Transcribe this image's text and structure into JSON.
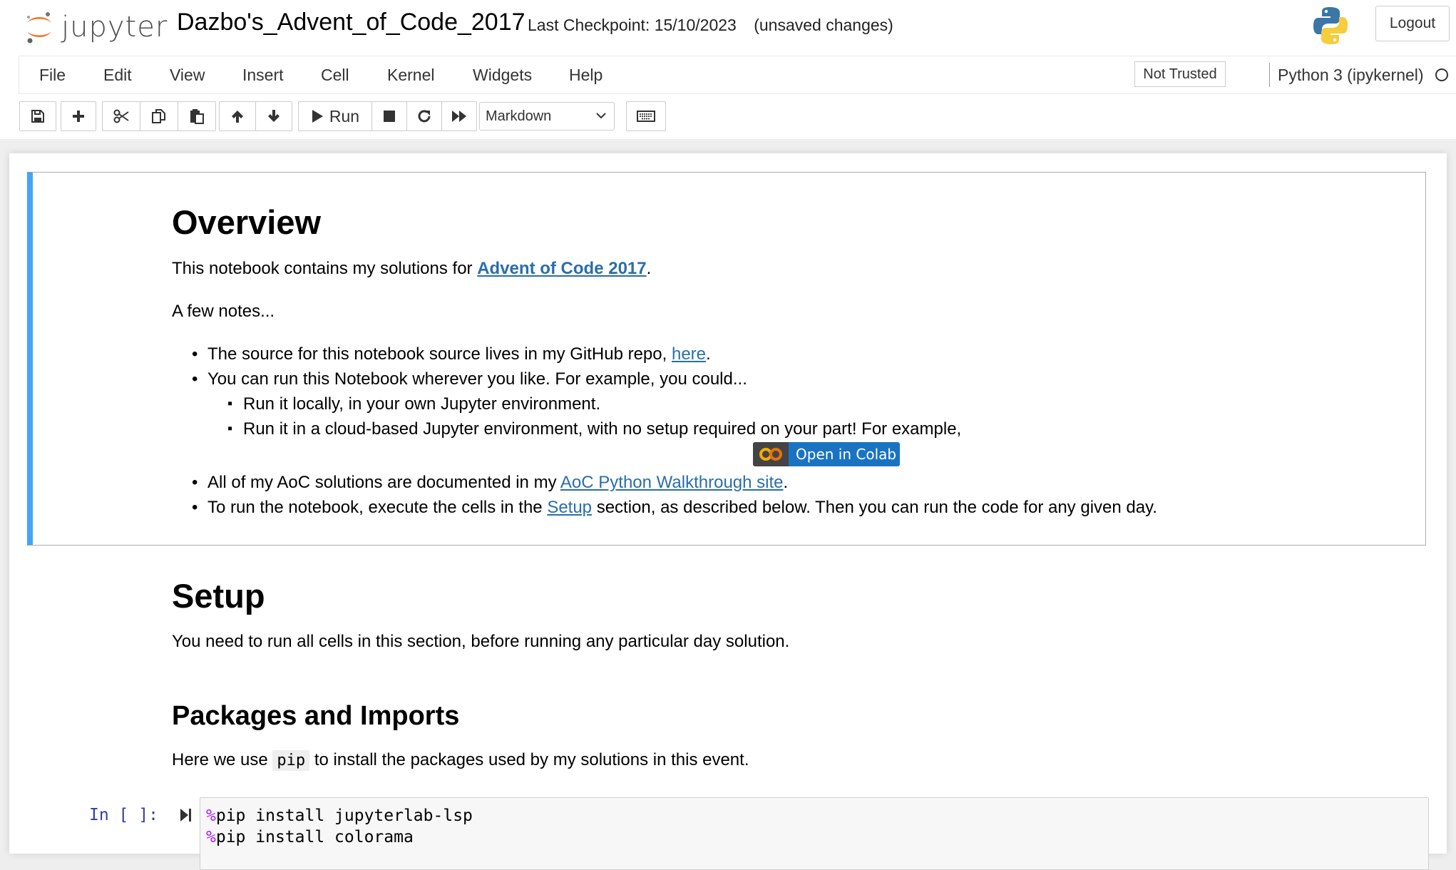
{
  "header": {
    "logo_text": "jupyter",
    "notebook_title": "Dazbo's_Advent_of_Code_2017",
    "checkpoint": "Last Checkpoint: 15/10/2023",
    "unsaved": "(unsaved changes)",
    "logout_label": "Logout"
  },
  "menubar": {
    "items": [
      "File",
      "Edit",
      "View",
      "Insert",
      "Cell",
      "Kernel",
      "Widgets",
      "Help"
    ],
    "trust_label": "Not Trusted",
    "kernel_name": "Python 3 (ipykernel)"
  },
  "toolbar": {
    "run_label": "Run",
    "cell_type": "Markdown",
    "icons": [
      "save-icon",
      "plus-icon",
      "cut-icon",
      "copy-icon",
      "paste-icon",
      "arrow-up-icon",
      "arrow-down-icon",
      "run-icon",
      "stop-icon",
      "restart-icon",
      "fast-forward-icon",
      "keyboard-icon"
    ]
  },
  "overview": {
    "heading": "Overview",
    "intro_pre": "This notebook contains my solutions for ",
    "intro_link": "Advent of Code 2017",
    "intro_post": ".",
    "notes": "A few notes...",
    "b1_pre": "The source for this notebook source lives in my GitHub repo, ",
    "b1_link": "here",
    "b1_post": ".",
    "b2": "You can run this Notebook wherever you like. For example, you could...",
    "b2a": "Run it locally, in your own Jupyter environment.",
    "b2b": "Run it in a cloud-based Jupyter environment, with no setup required on your part! For example,",
    "colab_badge": "Open in Colab",
    "b3_pre": "All of my AoC solutions are documented in my ",
    "b3_link": "AoC Python Walkthrough site",
    "b3_post": ".",
    "b4_pre": "To run the notebook, execute the cells in the ",
    "b4_link": "Setup",
    "b4_post": " section, as described below. Then you can run the code for any given day."
  },
  "setup": {
    "heading": "Setup",
    "text": "You need to run all cells in this section, before running any particular day solution."
  },
  "packages": {
    "heading": "Packages and Imports",
    "pre": "Here we use ",
    "code": "pip",
    "post": " to install the packages used by my solutions in this event."
  },
  "code_cell": {
    "prompt": "In [ ]:",
    "lines": [
      {
        "magic": "%",
        "text": "pip install jupyterlab-lsp"
      },
      {
        "magic": "%",
        "text": "pip install colorama"
      }
    ]
  },
  "colors": {
    "accent": "#42a5f5",
    "link": "#296eaa",
    "prompt": "#303f9f",
    "jupyter_orange": "#f37726"
  }
}
